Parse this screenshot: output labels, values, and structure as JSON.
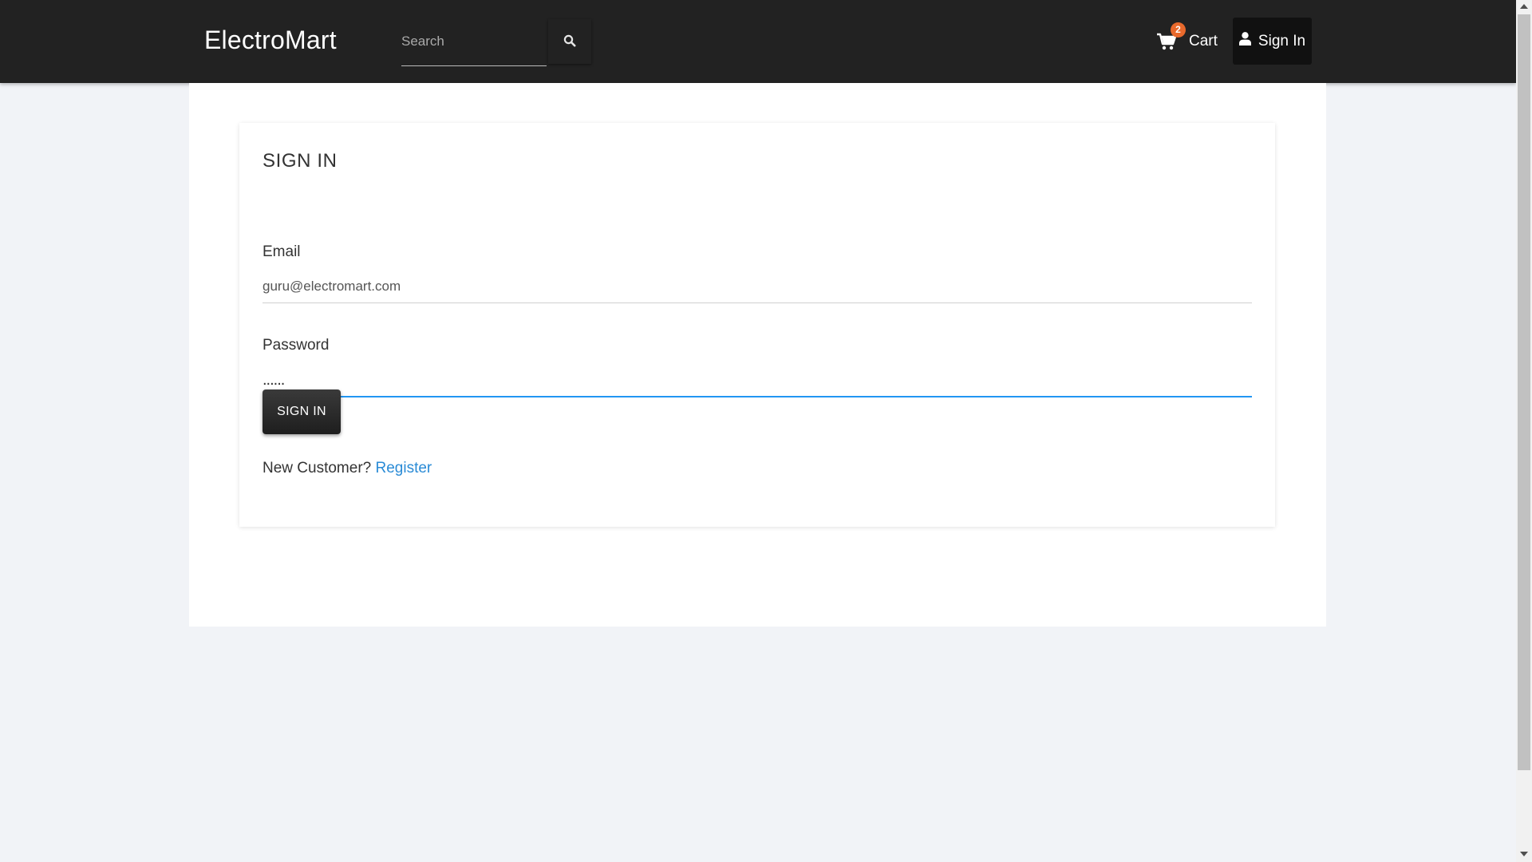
{
  "navbar": {
    "brand": "ElectroMart",
    "search": {
      "placeholder": "Search",
      "value": "",
      "button_icon": "search-icon"
    },
    "cart": {
      "label": "Cart",
      "count": "2",
      "icon": "shopping-cart-icon"
    },
    "signin": {
      "label": "Sign In",
      "icon": "user-icon"
    }
  },
  "signin_form": {
    "title": "SIGN IN",
    "email": {
      "label": "Email",
      "value": "guru@electromart.com"
    },
    "password": {
      "label": "Password",
      "value": "......"
    },
    "submit_label": "SIGN IN",
    "new_customer_text": "New Customer?",
    "register_link": "Register"
  },
  "colors": {
    "navbar": "#222222",
    "accent": "#2196f3",
    "link": "#2a8bd6",
    "badge": "#e8692c",
    "page_background": "#f1f3f7"
  }
}
